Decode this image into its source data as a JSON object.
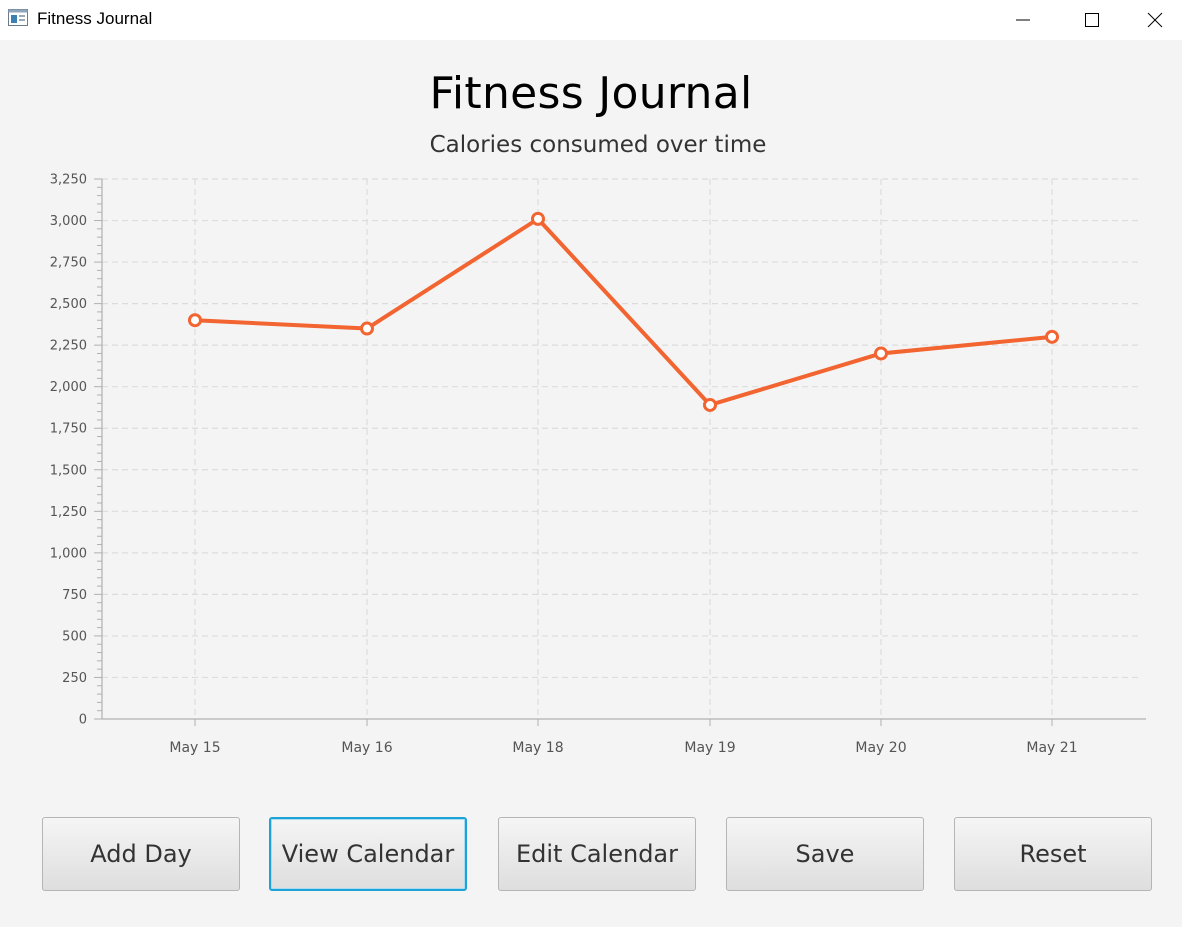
{
  "window": {
    "title": "Fitness Journal",
    "icon": "app-window-icon",
    "controls": [
      "minimize-icon",
      "maximize-icon",
      "close-icon"
    ]
  },
  "chart_data": {
    "type": "line",
    "title": "Fitness Journal",
    "subtitle": "Calories consumed over time",
    "xlabel": "",
    "ylabel": "",
    "categories": [
      "May 15",
      "May 16",
      "May 18",
      "May 19",
      "May 20",
      "May 21"
    ],
    "series": [
      {
        "values": [
          2400,
          2350,
          3010,
          1890,
          2200,
          2300
        ],
        "color": "#f26430"
      }
    ],
    "ylim": [
      0,
      3250
    ],
    "yticks": [
      0,
      250,
      500,
      750,
      1000,
      1250,
      1500,
      1750,
      2000,
      2250,
      2500,
      2750,
      3000,
      3250
    ],
    "ytick_labels": [
      "0",
      "250",
      "500",
      "750",
      "1,000",
      "1,250",
      "1,500",
      "1,750",
      "2,000",
      "2,250",
      "2,500",
      "2,750",
      "3,000",
      "3,250"
    ],
    "grid": true,
    "legend": "none"
  },
  "buttons": {
    "add_day": "Add Day",
    "view_calendar": "View Calendar",
    "edit_calendar": "Edit Calendar",
    "save": "Save",
    "reset": "Reset"
  },
  "colors": {
    "series": "#f26430",
    "focus": "#1ea3d8",
    "grid": "#dcdcdc",
    "background": "#f4f4f4"
  }
}
